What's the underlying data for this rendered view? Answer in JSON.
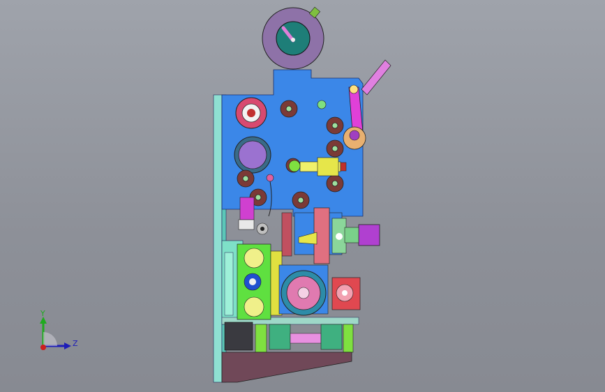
{
  "viewport": {
    "background_top": "#9fa3ab",
    "background_bottom": "#878a92"
  },
  "triad": {
    "y_label": "Y",
    "z_label": "Z",
    "y_color": "#1faa1f",
    "z_color": "#1d1db8",
    "x_color": "#cc1f1f"
  },
  "colors": {
    "main_plate": "#3b87e8",
    "frame_green": "#7ee0c8",
    "roller_dark": "#7b3a36",
    "magenta": "#e040d8",
    "purple": "#9b72d0",
    "yellow": "#e6e64a",
    "lime": "#5fe040",
    "base": "#704858"
  }
}
